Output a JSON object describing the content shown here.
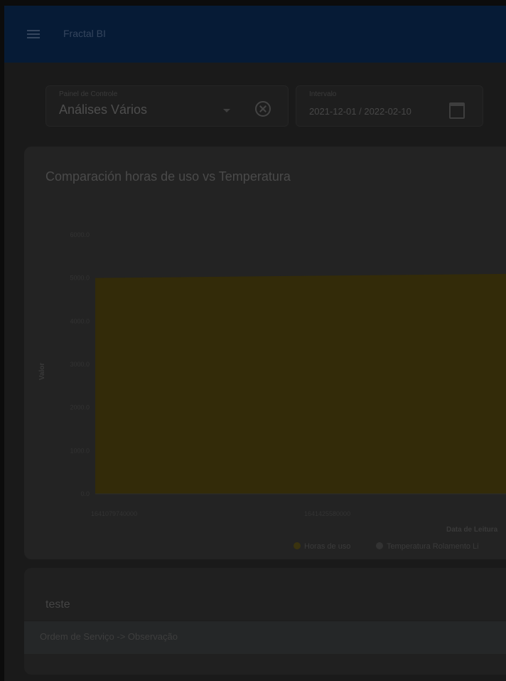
{
  "app": {
    "title": "Fractal BI"
  },
  "filters": {
    "panel": {
      "label": "Painel de Controle",
      "value": "Análises Vários"
    },
    "interval": {
      "label": "Intervalo",
      "value": "2021-12-01 / 2022-02-10"
    }
  },
  "chart_card": {
    "title": "Comparación horas de uso vs Temperatura"
  },
  "chart_data": {
    "type": "area",
    "title": "Comparación horas de uso vs Temperatura",
    "xlabel": "Data de Leitura",
    "ylabel": "Valor",
    "x_ticks": [
      "1641079740000",
      "1641425580000"
    ],
    "y_ticks": [
      "0.0",
      "1000.0",
      "2000.0",
      "3000.0",
      "4000.0",
      "5000.0",
      "6000.0"
    ],
    "ylim": [
      0,
      6000
    ],
    "x": [
      1641079740000,
      1641771420000
    ],
    "series": [
      {
        "name": "Horas de uso",
        "values": [
          5000,
          5100
        ],
        "color": "#332b09"
      },
      {
        "name": "Temperatura Rolamento Li",
        "values": [
          0,
          0
        ],
        "color": "#3a3a3a"
      }
    ],
    "legend_position": "bottom"
  },
  "list_card": {
    "title": "teste",
    "row": "Ordem de Serviço -> Observação"
  },
  "colors": {
    "topbar": "#061b36",
    "overlay_background": "#1a1a1a",
    "horas_fill": "#332b09"
  },
  "icons": {
    "menu": "menu-icon",
    "clear": "clear-circle-icon",
    "calendar": "calendar-icon",
    "dropdown": "chevron-down-icon"
  }
}
